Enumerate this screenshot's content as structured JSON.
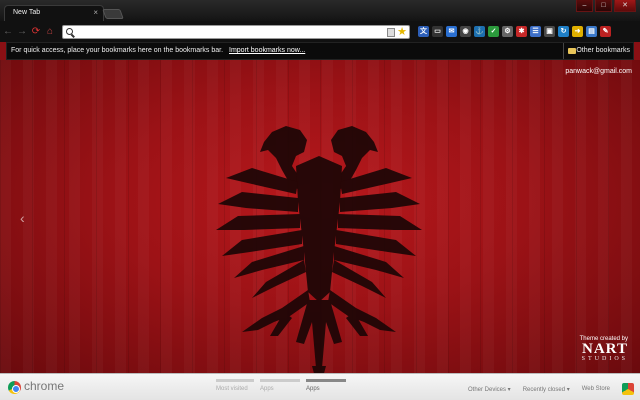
{
  "window": {
    "tab_title": "New Tab",
    "tab_close": "×",
    "controls": {
      "minimize": "–",
      "maximize": "□",
      "close": "✕"
    }
  },
  "toolbar": {
    "back": "←",
    "forward": "→",
    "reload": "⟳",
    "home": "⌂",
    "omnibox_value": "",
    "star": "★",
    "extensions": [
      {
        "name": "translate-icon",
        "glyph": "文",
        "color": "#2d5fb8"
      },
      {
        "name": "window-icon",
        "glyph": "▭",
        "color": "#333"
      },
      {
        "name": "chat-icon",
        "glyph": "✉",
        "color": "#2a6fd1"
      },
      {
        "name": "record-icon",
        "glyph": "◉",
        "color": "#444"
      },
      {
        "name": "anchor-icon",
        "glyph": "⚓",
        "color": "#1c6fb0"
      },
      {
        "name": "check-icon",
        "glyph": "✓",
        "color": "#2b9a3c"
      },
      {
        "name": "gear-icon",
        "glyph": "⚙",
        "color": "#666"
      },
      {
        "name": "star-ext-icon",
        "glyph": "✱",
        "color": "#c62828"
      },
      {
        "name": "list-icon",
        "glyph": "☰",
        "color": "#3d6fc8"
      },
      {
        "name": "box-icon",
        "glyph": "▣",
        "color": "#4a4a4a"
      },
      {
        "name": "refresh-ext-icon",
        "glyph": "↻",
        "color": "#1f7fc6"
      },
      {
        "name": "arrow-ext-icon",
        "glyph": "➜",
        "color": "#e0b000"
      },
      {
        "name": "screen-icon",
        "glyph": "▤",
        "color": "#3a78c9"
      },
      {
        "name": "wrench-icon",
        "glyph": "✎",
        "color": "#b22"
      }
    ]
  },
  "bookmarks_bar": {
    "message": "For quick access, place your bookmarks here on the bookmarks bar.",
    "import_link": "Import bookmarks now...",
    "other_bookmarks": "Other bookmarks"
  },
  "content": {
    "user_email": "panwack@gmail.com",
    "left_arrow": "‹",
    "theme_credit": {
      "label": "Theme created by",
      "brand": "NART",
      "sub": "STUDIOS"
    }
  },
  "bottom_bar": {
    "logo_text": "chrome",
    "tabs": [
      {
        "label": "Most visited"
      },
      {
        "label": "Apps"
      },
      {
        "label": "Apps"
      }
    ],
    "other_devices": "Other Devices ▾",
    "recently_closed": "Recently closed ▾",
    "web_store": "Web Store"
  },
  "colors": {
    "flag_red": "#b8181c",
    "eagle": "#1c0606"
  }
}
